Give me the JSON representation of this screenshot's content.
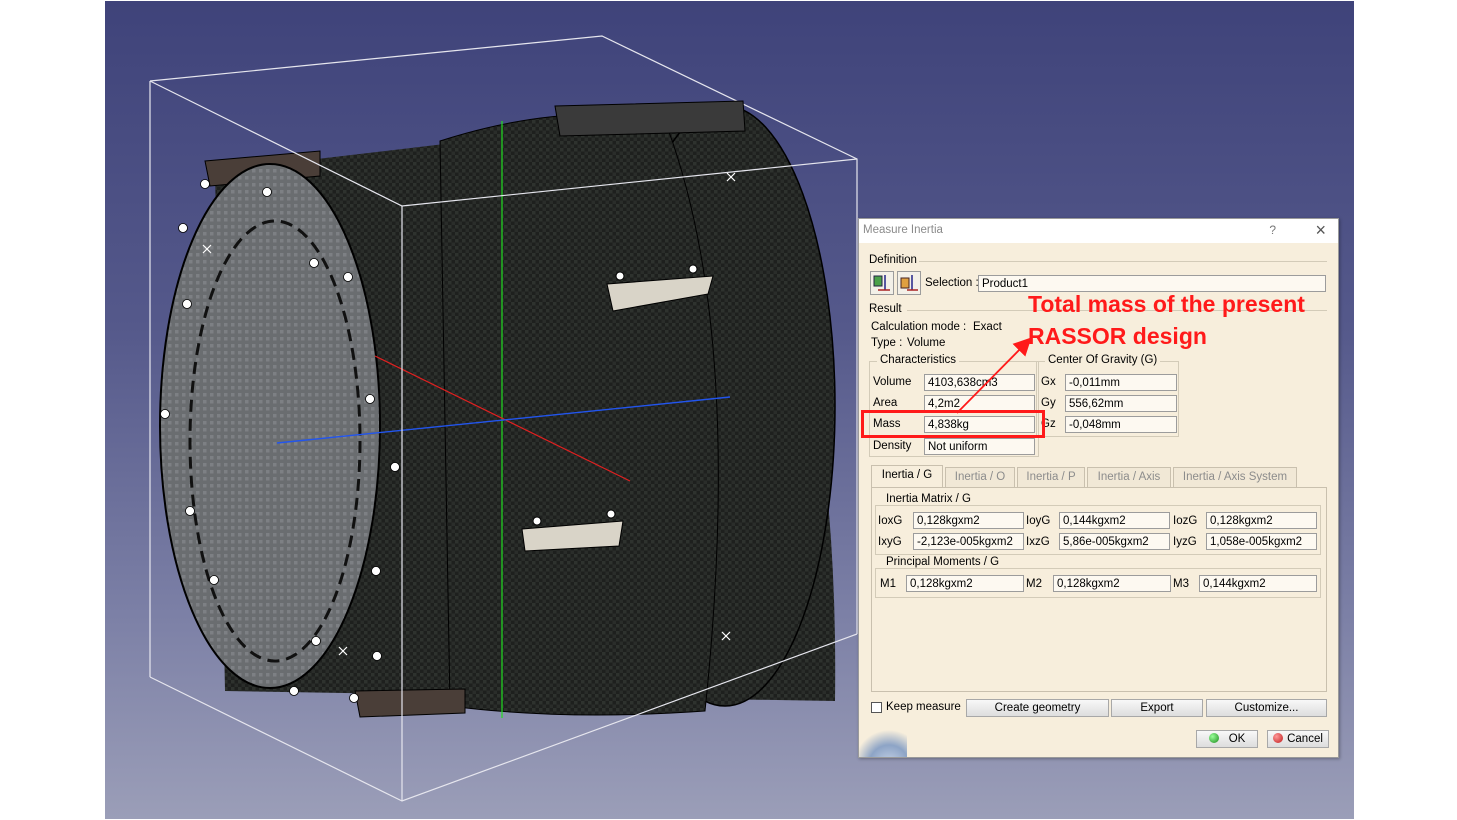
{
  "dialog": {
    "title": "Measure Inertia",
    "help_label": "?",
    "definition": {
      "section_label": "Definition",
      "selection_label": "Selection :",
      "selection_value": "Product1"
    },
    "result": {
      "section_label": "Result",
      "calc_mode_label": "Calculation mode :",
      "calc_mode_value": "Exact",
      "type_label": "Type :",
      "type_value": "Volume"
    },
    "characteristics": {
      "title": "Characteristics",
      "volume_label": "Volume",
      "volume_value": "4103,638cm3",
      "area_label": "Area",
      "area_value": "4,2m2",
      "mass_label": "Mass",
      "mass_value": "4,838kg",
      "density_label": "Density",
      "density_value": "Not uniform"
    },
    "center_of_gravity": {
      "title": "Center Of Gravity (G)",
      "gx_label": "Gx",
      "gx_value": "-0,011mm",
      "gy_label": "Gy",
      "gy_value": "556,62mm",
      "gz_label": "Gz",
      "gz_value": "-0,048mm"
    },
    "tabs": [
      "Inertia / G",
      "Inertia / O",
      "Inertia / P",
      "Inertia / Axis",
      "Inertia / Axis System"
    ],
    "inertia_matrix": {
      "title": "Inertia Matrix / G",
      "ioxg_label": "IoxG",
      "ioxg_value": "0,128kgxm2",
      "ioyg_label": "IoyG",
      "ioyg_value": "0,144kgxm2",
      "iozg_label": "IozG",
      "iozg_value": "0,128kgxm2",
      "ixyg_label": "IxyG",
      "ixyg_value": "-2,123e-005kgxm2",
      "ixzg_label": "IxzG",
      "ixzg_value": "5,86e-005kgxm2",
      "iyzg_label": "IyzG",
      "iyzg_value": "1,058e-005kgxm2"
    },
    "principal_moments": {
      "title": "Principal Moments / G",
      "m1_label": "M1",
      "m1_value": "0,128kgxm2",
      "m2_label": "M2",
      "m2_value": "0,128kgxm2",
      "m3_label": "M3",
      "m3_value": "0,144kgxm2"
    },
    "keep_measure_label": "Keep measure",
    "create_geometry_label": "Create geometry",
    "export_label": "Export",
    "customize_label": "Customize...",
    "ok_label": "OK",
    "cancel_label": "Cancel"
  },
  "annotation": {
    "line1": "Total mass of the present",
    "line2": "RASSOR design",
    "color": "#ff1a1a"
  },
  "viewport": {
    "background_top": "#3f437a",
    "background_bottom": "#9b9eb8"
  }
}
